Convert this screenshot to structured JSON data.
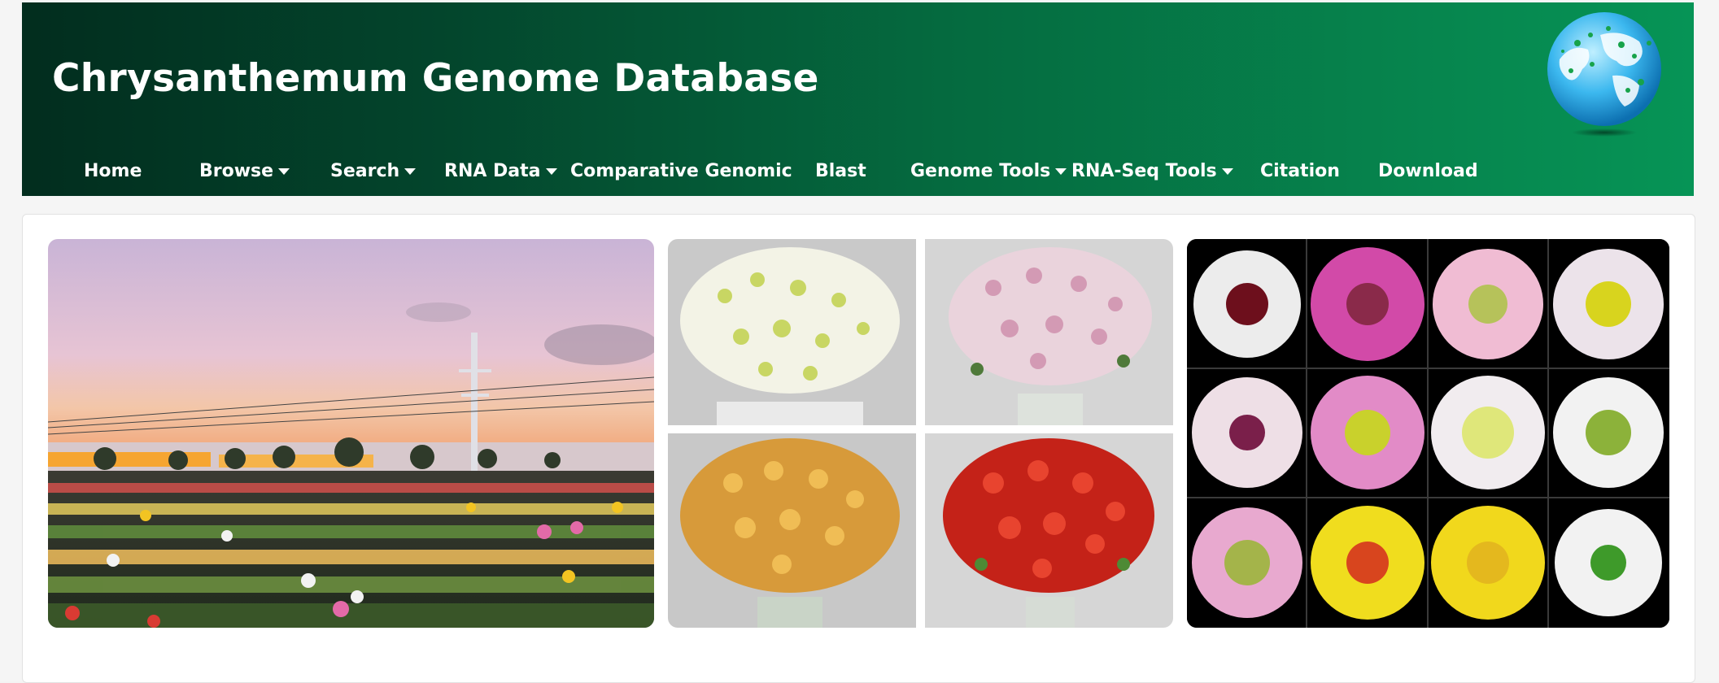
{
  "header": {
    "title": "Chrysanthemum Genome Database",
    "logo_icon": "globe-icon"
  },
  "nav": {
    "items": [
      {
        "label": "Home",
        "dropdown": false
      },
      {
        "label": "Browse",
        "dropdown": true
      },
      {
        "label": "Search",
        "dropdown": true
      },
      {
        "label": "RNA Data",
        "dropdown": true
      },
      {
        "label": "Comparative Genomic",
        "dropdown": false
      },
      {
        "label": "Blast",
        "dropdown": false
      },
      {
        "label": "Genome Tools",
        "dropdown": true
      },
      {
        "label": "RNA-Seq Tools",
        "dropdown": true
      },
      {
        "label": "Citation",
        "dropdown": false
      },
      {
        "label": "Download",
        "dropdown": false
      }
    ]
  },
  "colors": {
    "header_dark": "#022d1e",
    "header_light": "#069456",
    "nav_text": "#ffffff"
  },
  "gallery": {
    "images": [
      {
        "name": "chrysanthemum-field-sunset-photo"
      },
      {
        "name": "chrysanthemum-bouquet-grid-photo"
      },
      {
        "name": "chrysanthemum-flower-heads-grid-photo"
      }
    ]
  }
}
